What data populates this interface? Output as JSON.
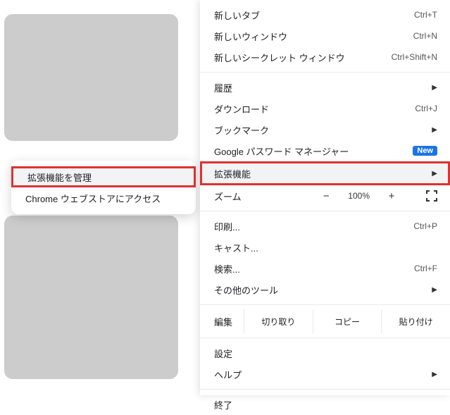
{
  "submenu": {
    "manage_extensions": "拡張機能を管理",
    "webstore": "Chrome ウェブストアにアクセス"
  },
  "menu": {
    "new_tab": {
      "label": "新しいタブ",
      "shortcut": "Ctrl+T"
    },
    "new_window": {
      "label": "新しいウィンドウ",
      "shortcut": "Ctrl+N"
    },
    "incognito": {
      "label": "新しいシークレット ウィンドウ",
      "shortcut": "Ctrl+Shift+N"
    },
    "history": {
      "label": "履歴"
    },
    "downloads": {
      "label": "ダウンロード",
      "shortcut": "Ctrl+J"
    },
    "bookmarks": {
      "label": "ブックマーク"
    },
    "password_manager": {
      "label": "Google パスワード マネージャー",
      "badge": "New"
    },
    "extensions": {
      "label": "拡張機能"
    },
    "zoom": {
      "label": "ズーム",
      "pct": "100%"
    },
    "print": {
      "label": "印刷...",
      "shortcut": "Ctrl+P"
    },
    "cast": {
      "label": "キャスト..."
    },
    "find": {
      "label": "検索...",
      "shortcut": "Ctrl+F"
    },
    "more_tools": {
      "label": "その他のツール"
    },
    "edit": {
      "label": "編集",
      "cut": "切り取り",
      "copy": "コピー",
      "paste": "貼り付け"
    },
    "settings": {
      "label": "設定"
    },
    "help": {
      "label": "ヘルプ"
    },
    "exit": {
      "label": "終了"
    }
  }
}
